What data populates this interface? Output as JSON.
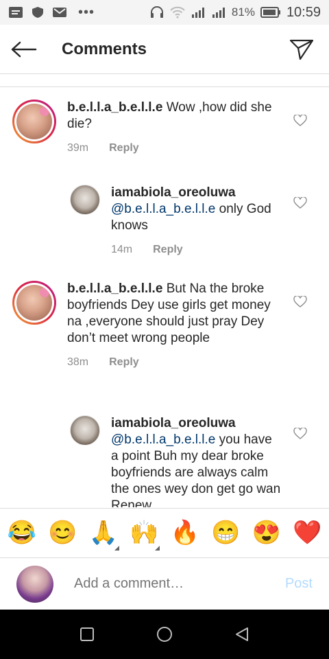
{
  "status_bar": {
    "battery_pct": "81%",
    "time": "10:59"
  },
  "header": {
    "title": "Comments"
  },
  "comments": [
    {
      "username": "b.e.l.l.a_b.e.l.l.e",
      "text": "Wow ,how did she die?",
      "mention": "",
      "time": "39m",
      "reply_label": "Reply"
    },
    {
      "username": "iamabiola_oreoluwa",
      "mention": "@b.e.l.l.a_b.e.l.l.e",
      "text": "only God knows",
      "time": "14m",
      "reply_label": "Reply"
    },
    {
      "username": "b.e.l.l.a_b.e.l.l.e",
      "mention": "",
      "text": "But Na the broke boyfriends Dey use girls get money na ,everyone should just pray Dey don’t meet  wrong people",
      "time": "38m",
      "reply_label": "Reply"
    },
    {
      "username": "iamabiola_oreoluwa",
      "mention": "@b.e.l.l.a_b.e.l.l.e",
      "text": "you have a point Buh my dear broke boyfriends are always calm the ones wey don get go wan Renew"
    }
  ],
  "emojis": [
    "😂",
    "😊",
    "🙏",
    "🙌",
    "🔥",
    "😁",
    "😍",
    "❤️"
  ],
  "composer": {
    "placeholder": "Add a comment…",
    "post_label": "Post"
  }
}
